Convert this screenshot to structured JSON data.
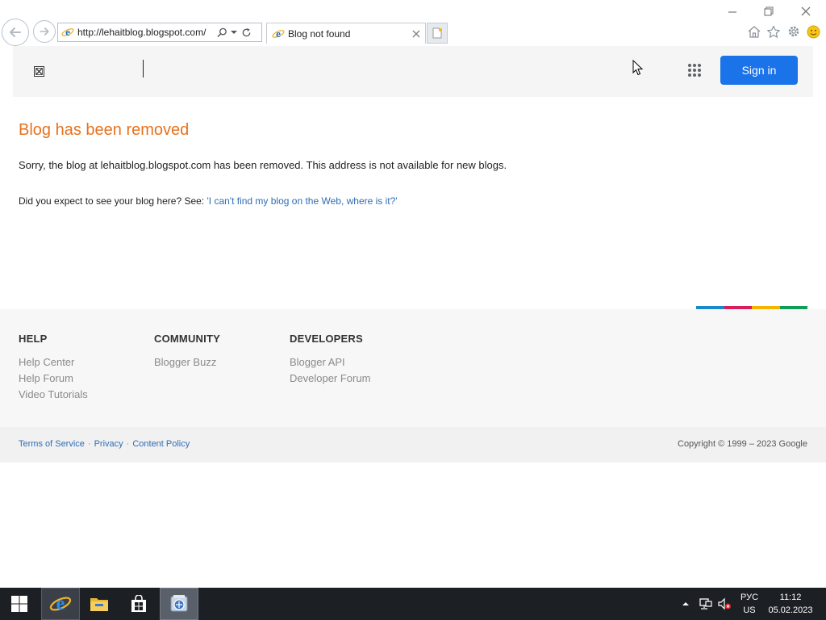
{
  "browser": {
    "url": "http://lehaitblog.blogspot.com/",
    "tab_title": "Blog not found",
    "colors": {
      "ie_blue": "#1e6fc8",
      "ie_gold": "#f0b429"
    },
    "icons": [
      "back-arrow-icon",
      "forward-arrow-icon",
      "ie-page-icon",
      "search-icon",
      "dropdown-arrow-icon",
      "refresh-icon",
      "close-icon",
      "new-tab-icon",
      "minimize-icon",
      "restore-icon",
      "window-close-icon",
      "home-icon",
      "favorites-star-icon",
      "gear-icon",
      "smiley-feedback-icon"
    ]
  },
  "header": {
    "signin_label": "Sign in",
    "icons": [
      "broken-image-icon",
      "apps-grid-icon"
    ],
    "colors": {
      "signin_bg": "#1a73e8",
      "header_bg": "#f5f5f5"
    }
  },
  "main": {
    "title": "Blog has been removed",
    "title_color": "#e8711d",
    "sorry_text": "Sorry, the blog at lehaitblog.blogspot.com has been removed. This address is not available for new blogs.",
    "expect_prefix": "Did you expect to see your blog here? See: ",
    "expect_link": "'I can't find my blog on the Web, where is it?'"
  },
  "google_bar_colors": [
    "#1a88c9",
    "#d81e5b",
    "#f4b400",
    "#0f9d58"
  ],
  "footer": {
    "help": {
      "heading": "HELP",
      "links": [
        "Help Center",
        "Help Forum",
        "Video Tutorials"
      ]
    },
    "community": {
      "heading": "COMMUNITY",
      "links": [
        "Blogger Buzz"
      ]
    },
    "developers": {
      "heading": "DEVELOPERS",
      "links": [
        "Blogger API",
        "Developer Forum"
      ]
    }
  },
  "legal": {
    "links": [
      "Terms of Service",
      "Privacy",
      "Content Policy"
    ],
    "separator": "·",
    "copyright": "Copyright © 1999 – 2023 Google"
  },
  "taskbar": {
    "apps": [
      "windows-start-icon",
      "internet-explorer-icon",
      "file-explorer-icon",
      "store-icon",
      "app-icon"
    ],
    "tray_icons": [
      "show-hidden-icons-icon",
      "network-icon",
      "volume-muted-icon"
    ],
    "lang_top": "РУС",
    "lang_bottom": "US",
    "time": "11:12",
    "date": "05.02.2023"
  }
}
